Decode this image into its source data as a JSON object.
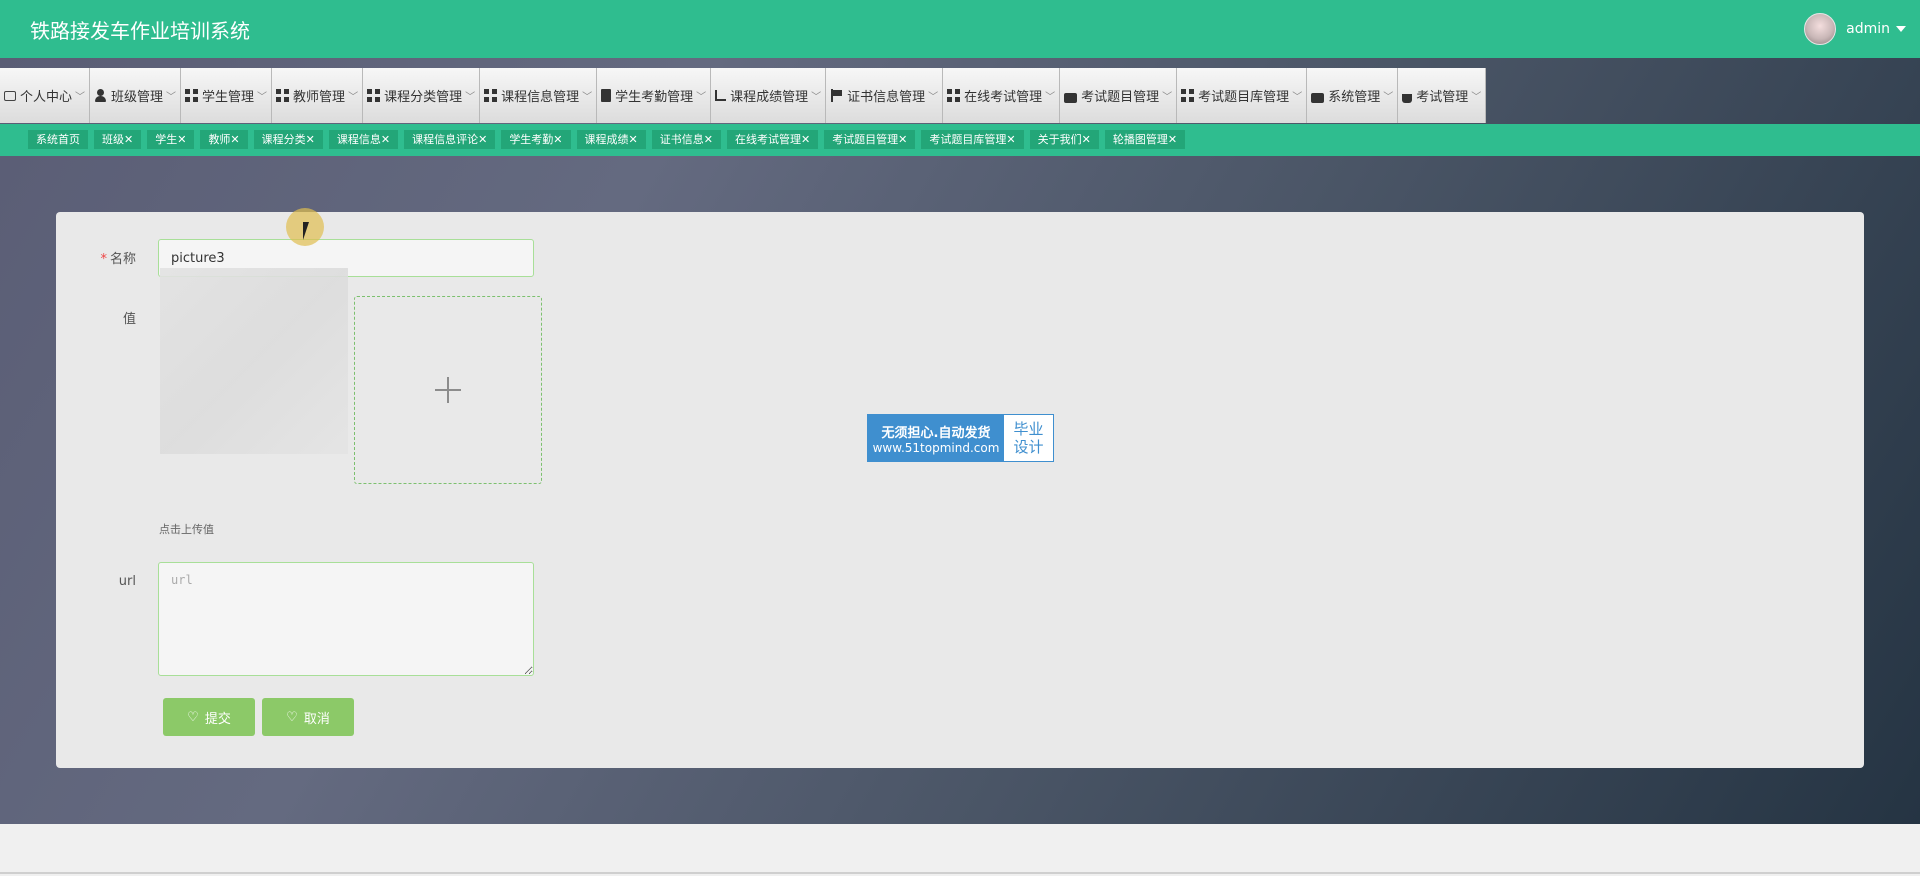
{
  "header": {
    "title": "铁路接发车作业培训系统",
    "username": "admin"
  },
  "menu": [
    {
      "label": "个人中心",
      "icon": "id-card-icon"
    },
    {
      "label": "班级管理",
      "icon": "user-icon"
    },
    {
      "label": "学生管理",
      "icon": "grid-icon"
    },
    {
      "label": "教师管理",
      "icon": "grid-icon"
    },
    {
      "label": "课程分类管理",
      "icon": "grid-icon"
    },
    {
      "label": "课程信息管理",
      "icon": "grid-icon"
    },
    {
      "label": "学生考勤管理",
      "icon": "clipboard-icon"
    },
    {
      "label": "课程成绩管理",
      "icon": "chart-icon"
    },
    {
      "label": "证书信息管理",
      "icon": "flag-icon"
    },
    {
      "label": "在线考试管理",
      "icon": "grid-icon"
    },
    {
      "label": "考试题目管理",
      "icon": "tray-icon"
    },
    {
      "label": "考试题目库管理",
      "icon": "grid-icon"
    },
    {
      "label": "系统管理",
      "icon": "briefcase-icon"
    },
    {
      "label": "考试管理",
      "icon": "coffee-icon"
    }
  ],
  "tabs": [
    {
      "label": "系统首页"
    },
    {
      "label": "班级✕"
    },
    {
      "label": "学生✕"
    },
    {
      "label": "教师✕"
    },
    {
      "label": "课程分类✕"
    },
    {
      "label": "课程信息✕"
    },
    {
      "label": "课程信息评论✕"
    },
    {
      "label": "学生考勤✕"
    },
    {
      "label": "课程成绩✕"
    },
    {
      "label": "证书信息✕"
    },
    {
      "label": "在线考试管理✕"
    },
    {
      "label": "考试题目管理✕"
    },
    {
      "label": "考试题目库管理✕"
    },
    {
      "label": "关于我们✕"
    },
    {
      "label": "轮播图管理✕"
    }
  ],
  "form": {
    "name_required_mark": "*",
    "name_label": "名称",
    "name_value": "picture3",
    "value_label": "值",
    "upload_hint": "点击上传值",
    "url_label": "url",
    "url_placeholder": "url",
    "submit_label": "提交",
    "cancel_label": "取消"
  },
  "watermark": {
    "line1": "无须担心.自动发货",
    "line2": "www.51topmind.com",
    "right1": "毕业",
    "right2": "设计"
  },
  "colors": {
    "header_green": "#2fbd8f",
    "tab_green": "#23a678",
    "button_green": "#8cc968",
    "watermark_blue": "#3f8fcf"
  }
}
